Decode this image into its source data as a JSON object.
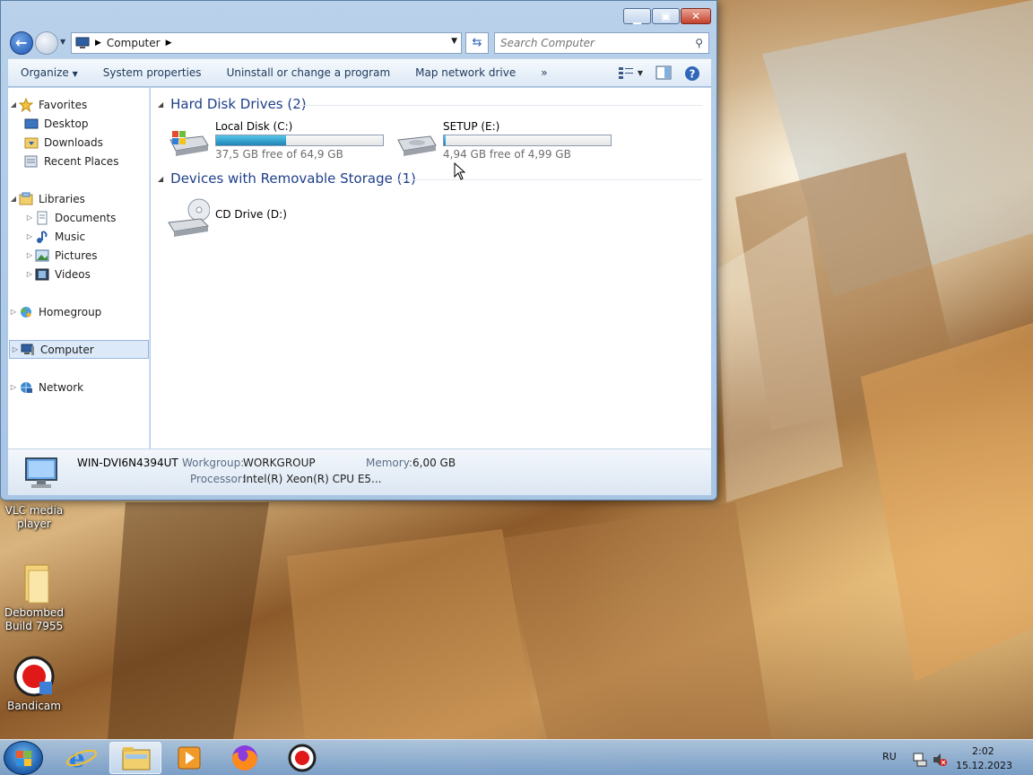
{
  "window": {
    "address": {
      "crumb": "Computer"
    },
    "search": {
      "placeholder": "Search Computer"
    },
    "toolbar": {
      "organize": "Organize",
      "system_properties": "System properties",
      "uninstall": "Uninstall or change a program",
      "map_network": "Map network drive",
      "more": "»"
    },
    "nav": {
      "favorites": "Favorites",
      "desktop": "Desktop",
      "downloads": "Downloads",
      "recent_places": "Recent Places",
      "libraries": "Libraries",
      "documents": "Documents",
      "music": "Music",
      "pictures": "Pictures",
      "videos": "Videos",
      "homegroup": "Homegroup",
      "computer": "Computer",
      "network": "Network"
    },
    "groups": {
      "hdd": "Hard Disk Drives (2)",
      "removable": "Devices with Removable Storage (1)"
    },
    "drives": {
      "c": {
        "name": "Local Disk (C:)",
        "free": "37,5 GB free of 64,9 GB",
        "used_fraction": 0.42
      },
      "e": {
        "name": "SETUP (E:)",
        "free": "4,94 GB free of 4,99 GB",
        "used_fraction": 0.01
      },
      "d": {
        "name": "CD Drive (D:)"
      }
    },
    "details": {
      "computer_name": "WIN-DVI6N4394UT",
      "workgroup_label": "Workgroup:",
      "workgroup": "WORKGROUP",
      "memory_label": "Memory:",
      "memory": "6,00 GB",
      "processor_label": "Processor:",
      "processor": "Intel(R) Xeon(R) CPU E5..."
    }
  },
  "desktop": {
    "vlc": "VLC media player",
    "debombed": "Debombed Build 7955",
    "bandicam": "Bandicam"
  },
  "taskbar": {
    "language": "RU",
    "time": "2:02",
    "date": "15.12.2023"
  },
  "colors": {
    "drive_bar": "#1d83b6",
    "group_header": "#1e3f8a",
    "selection": "#dbe9f9"
  }
}
